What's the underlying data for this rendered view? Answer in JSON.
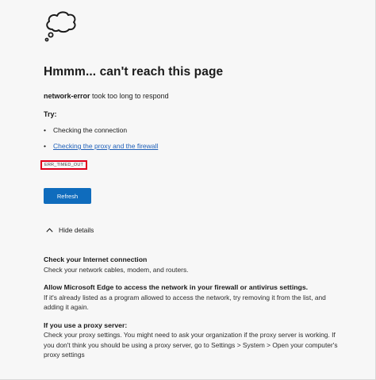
{
  "header": {
    "icon": "thought-cloud-icon",
    "title": "Hmmm... can't reach this page",
    "host": "network-error",
    "message": " took too long to respond"
  },
  "try": {
    "label": "Try:",
    "items": [
      {
        "text": "Checking the connection",
        "link": false
      },
      {
        "text": "Checking the proxy and the firewall",
        "link": true
      }
    ]
  },
  "error_code": "ERR_TIMED_OUT",
  "refresh_label": "Refresh",
  "details_toggle": {
    "icon": "chevron-up-icon",
    "label": "Hide details"
  },
  "details": [
    {
      "heading": "Check your Internet connection",
      "text": "Check your network cables, modem, and routers."
    },
    {
      "heading": "Allow Microsoft Edge to access the network in your firewall or antivirus settings.",
      "text": "If it's already listed as a program allowed to access the network, try removing it from the list, and adding it again."
    },
    {
      "heading": "If you use a proxy server:",
      "text": "Check your proxy settings. You might need to ask your organization if the proxy server is working. If you don't think you should be using a proxy server, go to Settings > System > Open your computer's proxy settings"
    }
  ],
  "colors": {
    "accent": "#0f6cbd",
    "link": "#1e5fb8",
    "highlight_box": "#e0001b",
    "background": "#f7f7f7"
  }
}
